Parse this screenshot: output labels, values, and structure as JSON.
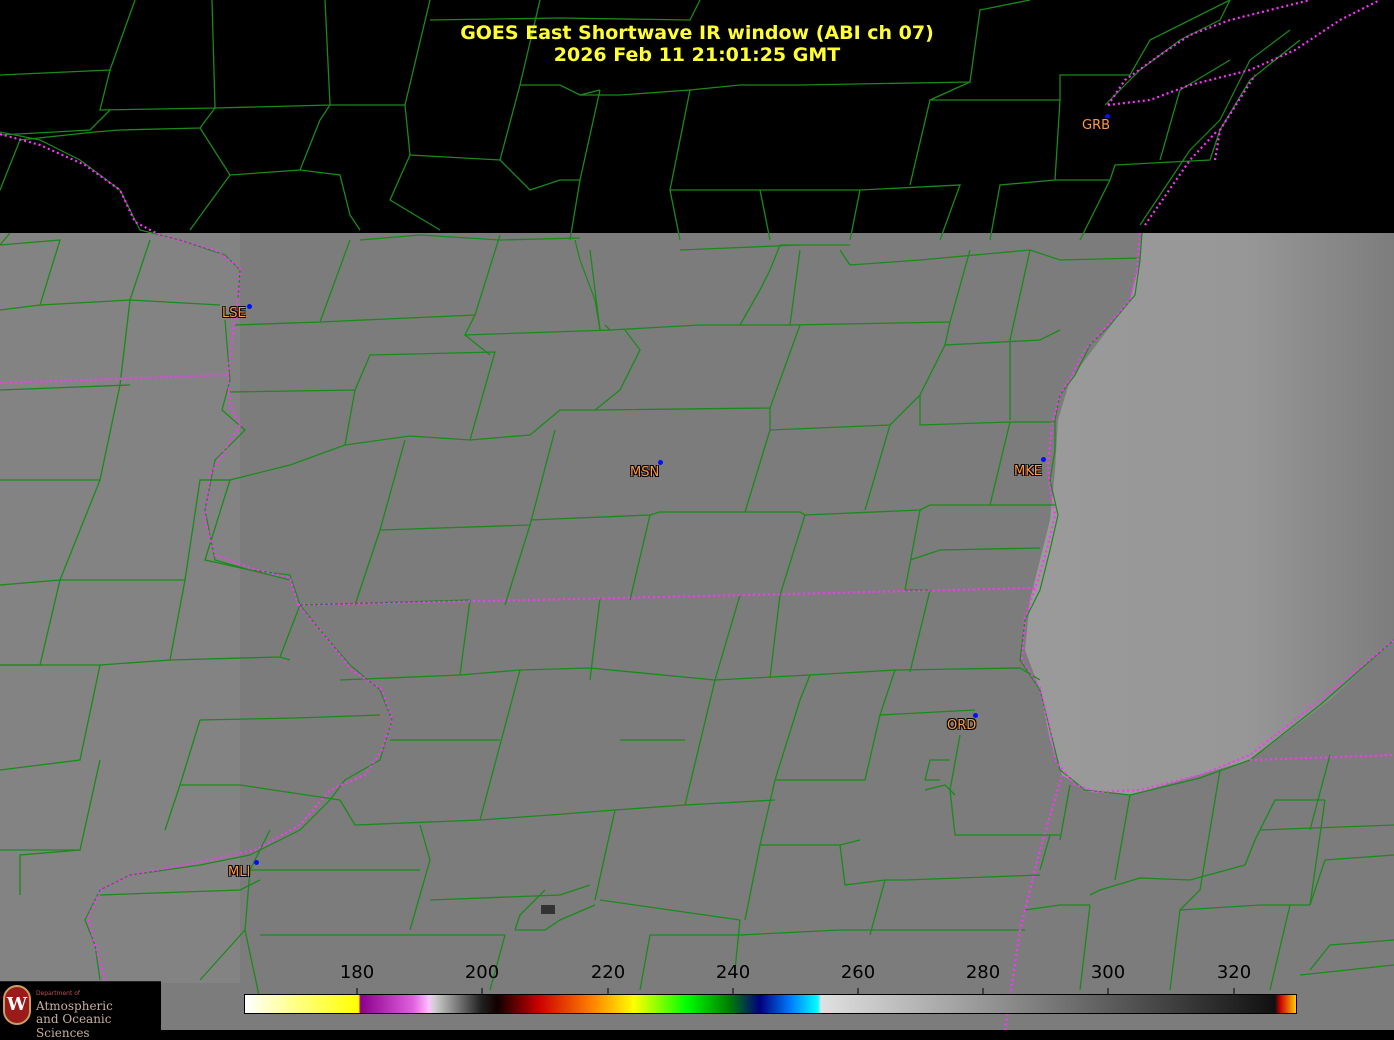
{
  "title": {
    "line1": "GOES East Shortwave IR window (ABI ch 07)",
    "line2": "2026 Feb 11  21:01:25 GMT"
  },
  "stations": [
    {
      "id": "lse",
      "label": "LSE"
    },
    {
      "id": "msn",
      "label": "MSN"
    },
    {
      "id": "mke",
      "label": "MKE"
    },
    {
      "id": "ord",
      "label": "ORD"
    },
    {
      "id": "mli",
      "label": "MLI"
    },
    {
      "id": "grb",
      "label": "GRB"
    }
  ],
  "colorbar": {
    "ticks": [
      "180",
      "200",
      "220",
      "240",
      "260",
      "280",
      "300",
      "320"
    ]
  },
  "logo": {
    "dept": "Department of",
    "line1": "Atmospheric",
    "line2": "and Oceanic Sciences"
  },
  "colors": {
    "title": "#ffff33",
    "county_lines": "#1a8a1a",
    "state_lines": "#ff33ff",
    "station_label": "#ff9a40",
    "station_dot": "#0010ff"
  }
}
